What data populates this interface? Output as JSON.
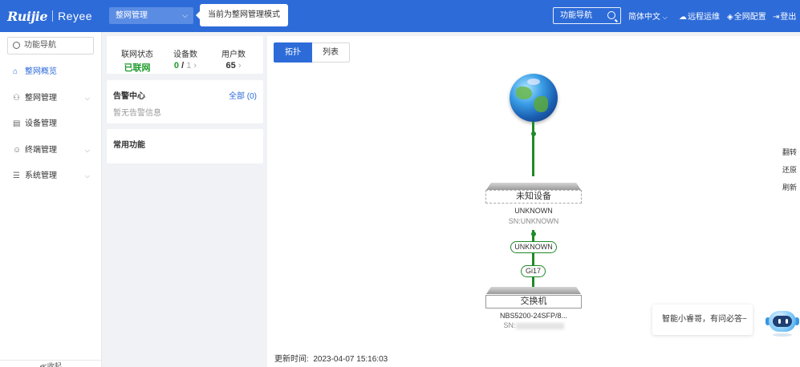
{
  "header": {
    "logo_brand": "Ruijie",
    "logo_product": "Reyee",
    "mode_select": "整网管理",
    "mode_tip": "当前为整网管理模式",
    "search_label": "功能导航",
    "language": "简体中文",
    "remote_ops": "远程运维",
    "network_config": "全网配置",
    "logout": "登出"
  },
  "sidebar": {
    "search_placeholder": "功能导航",
    "items": [
      {
        "label": "整网概览",
        "icon": "home-icon",
        "active": true
      },
      {
        "label": "整网管理",
        "icon": "network-icon",
        "expandable": true
      },
      {
        "label": "设备管理",
        "icon": "device-icon"
      },
      {
        "label": "终端管理",
        "icon": "user-icon",
        "expandable": true
      },
      {
        "label": "系统管理",
        "icon": "settings-icon",
        "expandable": true
      }
    ],
    "collapse_label": "≪收起"
  },
  "stats": {
    "network_status_label": "联网状态",
    "network_status_value": "已联网",
    "devices_label": "设备数",
    "devices_online": "0",
    "devices_sep": "/",
    "devices_total": "1",
    "users_label": "用户数",
    "users_value": "65"
  },
  "alarm": {
    "title": "告警中心",
    "all_link": "全部 (0)",
    "empty": "暂无告警信息"
  },
  "common": {
    "title": "常用功能"
  },
  "main": {
    "tabs": [
      "拓扑",
      "列表"
    ],
    "tools": [
      "翻转",
      "还原",
      "刷新"
    ],
    "update_label": "更新时间:",
    "update_time": "2023-04-07 15:16:03"
  },
  "topology": {
    "unknown_device": {
      "name": "未知设备",
      "model": "UNKNOWN",
      "sn": "SN:UNKNOWN"
    },
    "port_upper": "UNKNOWN",
    "port_lower": "Gi17",
    "switch": {
      "name": "交换机",
      "model": "NBS5200-24SFP/8...",
      "sn_prefix": "SN:"
    },
    "link_color": "#1e8a28"
  },
  "assistant": {
    "bubble": "智能小睿哥，有问必答~"
  },
  "colors": {
    "primary": "#2d6bd8",
    "status_green": "#1e9b2e"
  }
}
